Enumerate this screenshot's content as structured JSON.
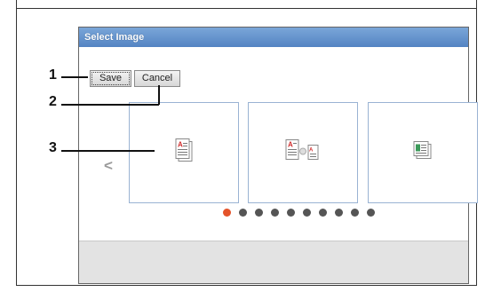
{
  "dialog": {
    "title": "Select Image",
    "buttons": {
      "save": "Save",
      "cancel": "Cancel"
    },
    "carousel": {
      "prev_label": "<",
      "cards": [
        {
          "icon": "document-icon"
        },
        {
          "icon": "document-transfer-icon"
        },
        {
          "icon": "image-document-icon"
        }
      ],
      "page_count": 10,
      "active_page": 1
    }
  },
  "callouts": [
    "1",
    "2",
    "3"
  ],
  "colors": {
    "title_bar": "#5484c3",
    "active_dot": "#e4532a",
    "inactive_dot": "#555555",
    "card_border": "#9ab3d3",
    "footer": "#e3e3e3"
  }
}
